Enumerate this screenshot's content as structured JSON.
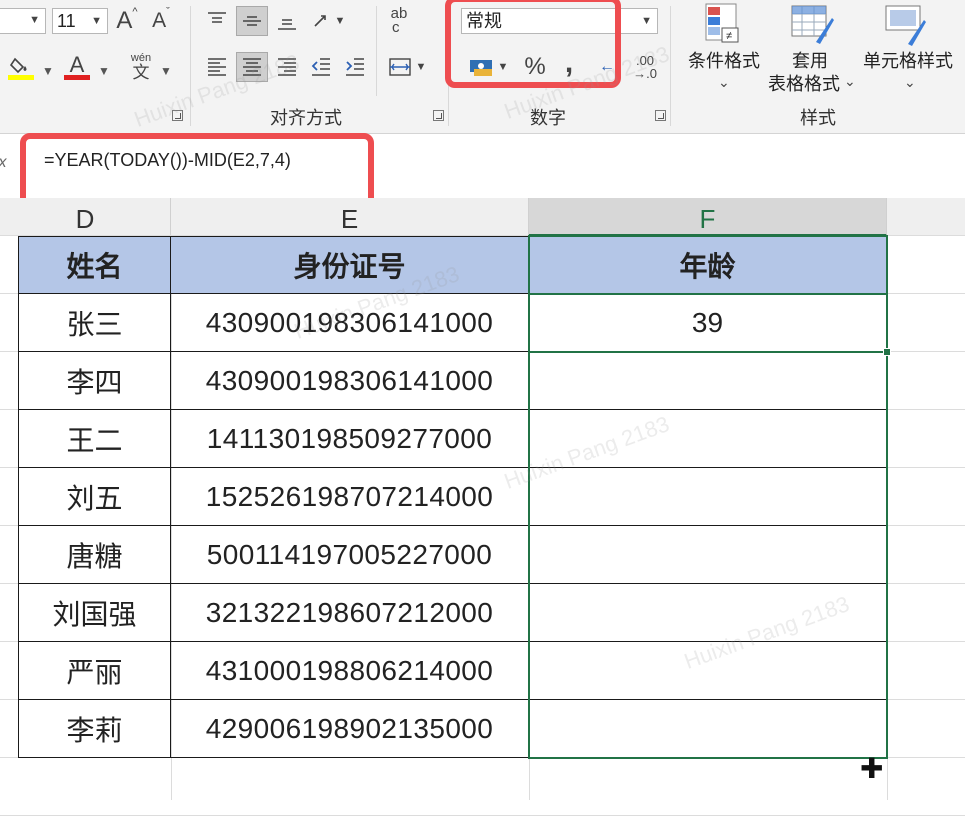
{
  "ribbon": {
    "font_size": "11",
    "font_grow_icon": "A",
    "font_shrink_icon": "A",
    "phonetic_top": "wén",
    "phonetic_bottom": "文",
    "wrap_text_icon_top": "ab",
    "wrap_text_icon_bottom": "c",
    "alignment_group_label": "对齐方式",
    "number_format_value": "常规",
    "percent_label": "%",
    "comma_label": ",",
    "increase_decimal_top": ".00",
    "increase_decimal_bottom": "→.0",
    "number_group_label": "数字",
    "conditional_format_label": "条件格式",
    "format_as_table_label_line1": "套用",
    "format_as_table_label_line2": "表格格式",
    "cell_styles_label": "单元格样式",
    "styles_group_label": "样式",
    "dropdown_glyph": "⌄",
    "colors": {
      "highlight_yellow": "#ffff00",
      "font_red": "#e02020",
      "annotation_red": "#ee4d50",
      "header_blue": "#b4c6e7",
      "selection_green": "#217346"
    }
  },
  "formula_bar": {
    "fx_icon": "fx",
    "formula": "=YEAR(TODAY())-MID(E2,7,4)"
  },
  "columns": {
    "d": "D",
    "e": "E",
    "f": "F"
  },
  "table": {
    "headers": [
      "姓名",
      "身份证号",
      "年龄"
    ],
    "rows": [
      [
        "张三",
        "430900198306141000",
        "39"
      ],
      [
        "李四",
        "430900198306141000",
        ""
      ],
      [
        "王二",
        "141130198509277000",
        ""
      ],
      [
        "刘五",
        "152526198707214000",
        ""
      ],
      [
        "唐糖",
        "500114197005227000",
        ""
      ],
      [
        "刘国强",
        "321322198607212000",
        ""
      ],
      [
        "严丽",
        "431000198806214000",
        ""
      ],
      [
        "李莉",
        "429006198902135000",
        ""
      ]
    ]
  },
  "cursor": "✚",
  "watermark_text": "Huixin Pang 2183"
}
